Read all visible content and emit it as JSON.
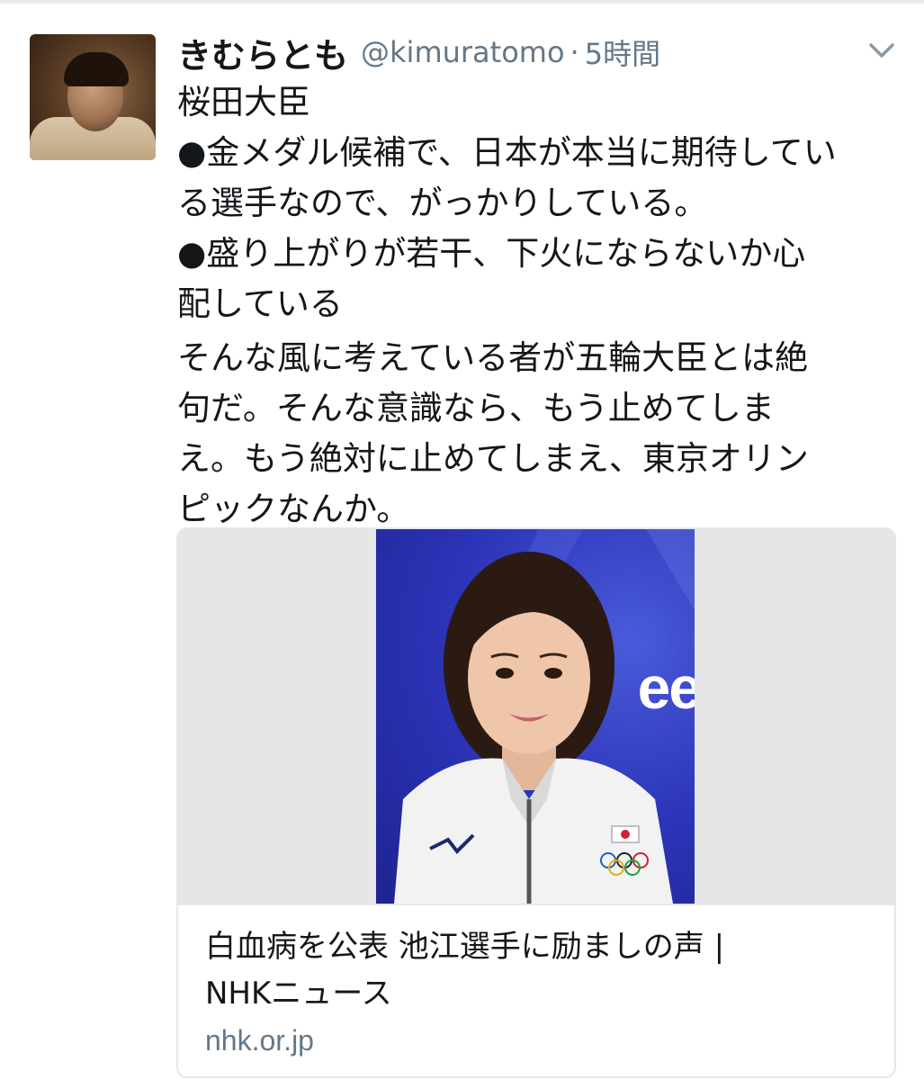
{
  "tweet": {
    "display_name": "きむらとも",
    "handle": "@kimuratomo",
    "separator": "·",
    "time": "5時間",
    "body_lines": [
      "桜田大臣",
      "●金メダル候補で、日本が本当に期待してい",
      "る選手なので、がっかりしている。",
      "●盛り上がりが若干、下火にならないか心",
      "配している"
    ],
    "body_lines_2": [
      "そんな風に考えている者が五輪大臣とは絶",
      "句だ。そんな意識なら、もう止めてしま",
      "え。もう絶対に止めてしまえ、東京オリン",
      "ピックなんか。"
    ]
  },
  "card": {
    "photo_text": "ee",
    "title_lines": [
      "白血病を公表 池江選手に励ましの声 |",
      "NHKニュース"
    ],
    "domain": "nhk.or.jp"
  },
  "icons": {
    "menu": "chevron-down-icon"
  },
  "colors": {
    "text": "#14171a",
    "secondary": "#657786",
    "border": "#e1e8ed",
    "photo_bg": "#2c34b8"
  }
}
